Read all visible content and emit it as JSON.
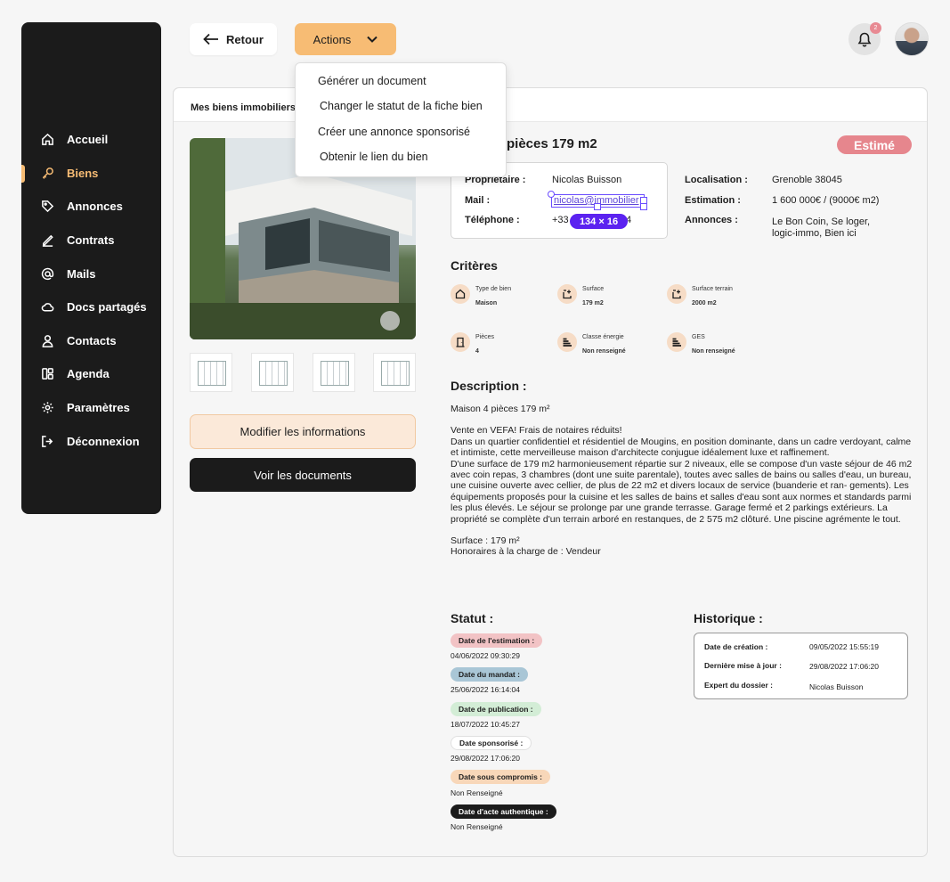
{
  "sidebar": {
    "items": [
      {
        "label": "Accueil",
        "icon": "home-icon"
      },
      {
        "label": "Biens",
        "icon": "key-icon",
        "active": true
      },
      {
        "label": "Annonces",
        "icon": "tag-icon"
      },
      {
        "label": "Contrats",
        "icon": "pen-icon"
      },
      {
        "label": "Mails",
        "icon": "at-icon"
      },
      {
        "label": "Docs partagés",
        "icon": "cloud-icon"
      },
      {
        "label": "Contacts",
        "icon": "user-icon"
      },
      {
        "label": "Agenda",
        "icon": "calendar-icon"
      },
      {
        "label": "Paramètres",
        "icon": "gear-icon"
      },
      {
        "label": "Déconnexion",
        "icon": "logout-icon"
      }
    ]
  },
  "topbar": {
    "back_label": "Retour",
    "actions_label": "Actions",
    "notification_count": "2"
  },
  "actions_menu": [
    "Générer un document",
    "Changer le statut de la fiche bien",
    "Créer une annonce sponsorisé",
    "Obtenir le lien du bien"
  ],
  "breadcrumb": "Mes biens immobiliers",
  "property": {
    "title": "pièces 179 m2",
    "status": "Estimé",
    "owner_label": "Propriétaire :",
    "owner": "Nicolas Buisson",
    "mail_label": "Mail :",
    "mail": "nicolas@immobilier",
    "phone_label": "Téléphone :",
    "phone_start": "+33",
    "phone_end": "4",
    "measure_overlay": "134 × 16",
    "location_label": "Localisation :",
    "location": "Grenoble 38045",
    "estimation_label": "Estimation :",
    "estimation": "1 600 000€ / (9000€ m2)",
    "ads_label": "Annonces :",
    "ads_line1": "Le Bon Coin, Se loger,",
    "ads_line2": "logic-immo, Bien ici"
  },
  "buttons": {
    "modify": "Modifier les informations",
    "documents": "Voir les documents"
  },
  "criteria": {
    "heading": "Critères",
    "items": [
      {
        "label": "Type de bien",
        "value": "Maison",
        "icon": "house-icon"
      },
      {
        "label": "Surface",
        "value": "179 m2",
        "icon": "area-icon"
      },
      {
        "label": "Surface terrain",
        "value": "2000 m2",
        "icon": "land-icon"
      },
      {
        "label": "Pièces",
        "value": "4",
        "icon": "door-icon"
      },
      {
        "label": "Classe énergie",
        "value": "Non renseigné",
        "icon": "energy-bars-icon"
      },
      {
        "label": "GES",
        "value": "Non renseigné",
        "icon": "ges-bars-icon"
      }
    ]
  },
  "description": {
    "heading": "Description :",
    "paragraphs": [
      "Maison 4 pièces 179 m²",
      "Vente en VEFA! Frais de notaires réduits!\nDans un quartier confidentiel et résidentiel de Mougins, en position dominante, dans un cadre verdoyant, calme et intimiste, cette merveilleuse maison d'architecte conjugue idéalement luxe et raffinement.\nD'une surface de 179 m2 harmonieusement répartie sur 2 niveaux, elle se compose d'un vaste séjour de 46 m2 avec coin repas, 3 chambres (dont une suite parentale), toutes avec salles de bains ou salles d'eau, un bureau, une cuisine ouverte avec cellier, de plus de 22 m2 et divers locaux de service (buanderie et ran- gements). Les équipements proposés pour la cuisine et les salles de bains et salles d'eau sont aux normes et standards parmi les plus élevés. Le séjour se prolonge par une grande terrasse. Garage fermé et 2 parkings extérieurs. La propriété se complète d'un terrain arboré en restanques, de 2 575 m2 clôturé. Une piscine agrémente le tout.",
      "Surface : 179 m²\nHonoraires à la charge de : Vendeur"
    ]
  },
  "statut": {
    "heading": "Statut :",
    "items": [
      {
        "label": "Date de l'estimation :",
        "date": "04/06/2022 09:30:29",
        "color": "#f2c3c5"
      },
      {
        "label": "Date du mandat :",
        "date": "25/06/2022 16:14:04",
        "color": "#a9c6d6"
      },
      {
        "label": "Date de publication :",
        "date": "18/07/2022 10:45:27",
        "color": "#d3edd6"
      },
      {
        "label": "Date sponsorisé :",
        "date": "29/08/2022 17:06:20",
        "color": "#ffffff"
      },
      {
        "label": "Date sous compromis :",
        "date": "Non Renseigné",
        "color": "#f8d7b9"
      },
      {
        "label": "Date d'acte authentique :",
        "date": "Non Renseigné",
        "color": "#1b1b1b"
      }
    ]
  },
  "historique": {
    "heading": "Historique :",
    "creation_label": "Date de création :",
    "creation": "09/05/2022 15:55:19",
    "update_label": "Dernière mise à jour :",
    "update": "29/08/2022 17:06:20",
    "expert_label": "Expert du dossier :",
    "expert": "Nicolas Buisson"
  },
  "colors": {
    "accent": "#f7bc74",
    "sidebar_bg": "#1b1b1b",
    "status_estime": "#e6868d"
  }
}
